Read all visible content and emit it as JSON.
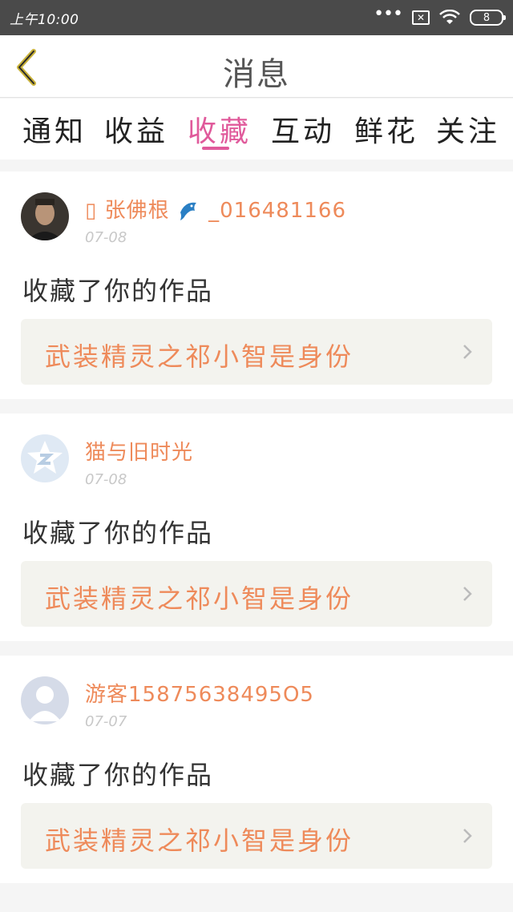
{
  "status_bar": {
    "time": "上午10:00",
    "dots": "•••",
    "sim_glyph": "✕",
    "battery_level": "8"
  },
  "header": {
    "title": "消息"
  },
  "tabs": [
    {
      "label": "通知",
      "active": false
    },
    {
      "label": "收益",
      "active": false
    },
    {
      "label": "收藏",
      "active": true
    },
    {
      "label": "互动",
      "active": false
    },
    {
      "label": "鲜花",
      "active": false
    },
    {
      "label": "关注",
      "active": false
    }
  ],
  "messages": [
    {
      "username": "▯ 张佛根",
      "username_suffix": "_016481166",
      "date": "07-08",
      "action": "收藏了你的作品",
      "work_title": "武装精灵之祁小智是身份",
      "avatar": "photo-avatar"
    },
    {
      "username": "猫与旧时光",
      "username_suffix": "",
      "date": "07-08",
      "action": "收藏了你的作品",
      "work_title": "武装精灵之祁小智是身份",
      "avatar": "qzone-avatar"
    },
    {
      "username": "游客15875638495O5",
      "username_suffix": "",
      "date": "07-07",
      "action": "收藏了你的作品",
      "work_title": "武装精灵之祁小智是身份",
      "avatar": "default-user-avatar"
    }
  ],
  "colors": {
    "accent": "#e05a9b",
    "username": "#ee8a5a",
    "status_bar": "#4a4a4a"
  }
}
